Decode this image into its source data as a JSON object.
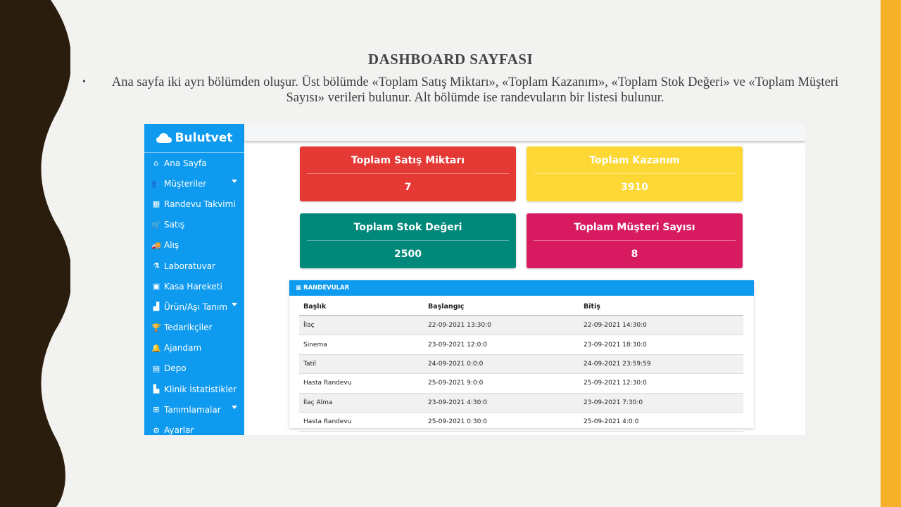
{
  "slide": {
    "title": "DASHBOARD SAYFASI",
    "bullet": "Ana sayfa iki ayrı bölümden oluşur. Üst bölümde «Toplam Satış Miktarı», «Toplam Kazanım», «Toplam Stok Değeri» ve «Toplam Müşteri Sayısı» verileri bulunur. Alt bölümde ise randevuların bir listesi bulunur."
  },
  "app": {
    "brand": "Bulutvet",
    "sidebar": [
      {
        "label": "Ana Sayfa",
        "icon": "home-icon"
      },
      {
        "label": "Müşteriler",
        "icon": "users-icon",
        "caret": true
      },
      {
        "label": "Randevu Takvimi",
        "icon": "calendar-icon"
      },
      {
        "label": "Satış",
        "icon": "cart-icon"
      },
      {
        "label": "Alış",
        "icon": "truck-icon"
      },
      {
        "label": "Laboratuvar",
        "icon": "flask-icon"
      },
      {
        "label": "Kasa Hareketi",
        "icon": "money-icon"
      },
      {
        "label": "Ürün/Aşı Tanım",
        "icon": "boxes-icon",
        "caret": true
      },
      {
        "label": "Tedarikçiler",
        "icon": "trophy-icon"
      },
      {
        "label": "Ajandam",
        "icon": "bell-icon"
      },
      {
        "label": "Depo",
        "icon": "archive-icon"
      },
      {
        "label": "Klinik İstatistikler",
        "icon": "chart-icon"
      },
      {
        "label": "Tanımlamalar",
        "icon": "plus-square-icon",
        "caret": true
      },
      {
        "label": "Ayarlar",
        "icon": "gear-icon"
      }
    ],
    "cards": [
      {
        "title": "Toplam Satış Miktarı",
        "value": "7",
        "color": "#e53935"
      },
      {
        "title": "Toplam Kazanım",
        "value": "3910",
        "color": "#fdd835"
      },
      {
        "title": "Toplam Stok Değeri",
        "value": "2500",
        "color": "#00897b"
      },
      {
        "title": "Toplam Müşteri Sayısı",
        "value": "8",
        "color": "#d81b60"
      }
    ],
    "appointments": {
      "heading": "RANDEVULAR",
      "columns": [
        "Başlık",
        "Başlangıç",
        "Bitiş"
      ],
      "rows": [
        [
          "İlaç",
          "22-09-2021 13:30:0",
          "22-09-2021 14:30:0"
        ],
        [
          "Sinema",
          "23-09-2021 12:0:0",
          "23-09-2021 18:30:0"
        ],
        [
          "Tatil",
          "24-09-2021 0:0:0",
          "24-09-2021 23:59:59"
        ],
        [
          "Hasta Randevu",
          "25-09-2021 9:0:0",
          "25-09-2021 12:30:0"
        ],
        [
          "İlaç Alma",
          "23-09-2021 4:30:0",
          "23-09-2021 7:30:0"
        ],
        [
          "Hasta Randevu",
          "25-09-2021 0:30:0",
          "25-09-2021 4:0:0"
        ]
      ]
    }
  }
}
